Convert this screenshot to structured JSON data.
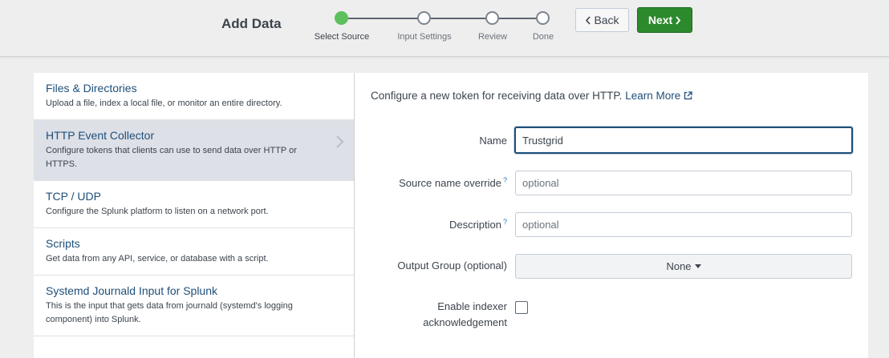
{
  "header": {
    "title": "Add Data",
    "back_label": "Back",
    "next_label": "Next",
    "steps": [
      {
        "label": "Select Source",
        "active": true
      },
      {
        "label": "Input Settings",
        "active": false
      },
      {
        "label": "Review",
        "active": false
      },
      {
        "label": "Done",
        "active": false
      }
    ]
  },
  "sources": [
    {
      "title": "Files & Directories",
      "description": "Upload a file, index a local file, or monitor an entire directory.",
      "selected": false
    },
    {
      "title": "HTTP Event Collector",
      "description": "Configure tokens that clients can use to send data over HTTP or HTTPS.",
      "selected": true
    },
    {
      "title": "TCP / UDP",
      "description": "Configure the Splunk platform to listen on a network port.",
      "selected": false
    },
    {
      "title": "Scripts",
      "description": "Get data from any API, service, or database with a script.",
      "selected": false
    },
    {
      "title": "Systemd Journald Input for Splunk",
      "description": "This is the input that gets data from journald (systemd's logging component) into Splunk.",
      "selected": false
    }
  ],
  "form": {
    "intro_text": "Configure a new token for receiving data over HTTP.",
    "learn_more": "Learn More",
    "name_label": "Name",
    "name_value": "Trustgrid",
    "source_label": "Source name override",
    "source_placeholder": "optional",
    "description_label": "Description",
    "description_placeholder": "optional",
    "help_mark": "?",
    "output_label": "Output Group (optional)",
    "output_value": "None",
    "ack_label": "Enable indexer acknowledgement"
  },
  "colors": {
    "accent": "#1e4e79",
    "next_button": "#2c8a2c",
    "active_step": "#5cc05c",
    "selected_item": "#dde0e6"
  }
}
